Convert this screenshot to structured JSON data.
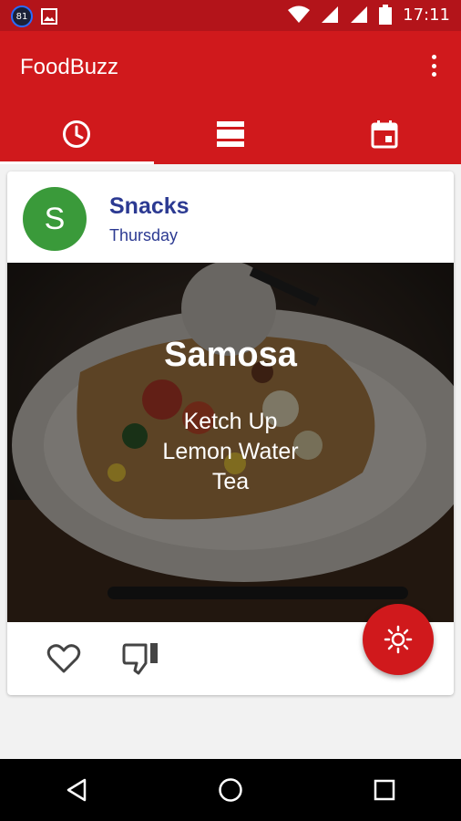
{
  "status_bar": {
    "notification_badge": "81",
    "time": "17:11",
    "icons": [
      "image-icon",
      "wifi-icon",
      "signal-icon",
      "signal-icon",
      "battery-icon"
    ]
  },
  "app_bar": {
    "title": "FoodBuzz",
    "menu_icon": "more-vert-icon"
  },
  "tabs": [
    {
      "icon": "clock-icon",
      "selected": true
    },
    {
      "icon": "view-list-icon",
      "selected": false
    },
    {
      "icon": "calendar-icon",
      "selected": false
    }
  ],
  "card": {
    "avatar_letter": "S",
    "title": "Snacks",
    "subtitle": "Thursday",
    "dish": "Samosa",
    "sides": [
      "Ketch Up",
      "Lemon Water",
      "Tea"
    ],
    "actions": [
      "heart-icon",
      "thumb-down-icon"
    ]
  },
  "fab": {
    "icon": "brightness-icon"
  },
  "nav_bar": [
    "back-icon",
    "home-icon",
    "recents-icon"
  ],
  "colors": {
    "status_bar": "#b3141a",
    "primary": "#d0191c",
    "avatar": "#3a9a3a",
    "title_text": "#2c3a92"
  }
}
